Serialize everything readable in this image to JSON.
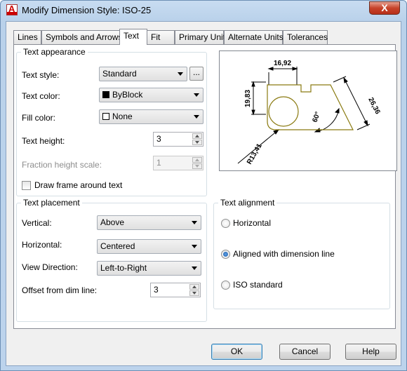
{
  "window": {
    "title": "Modify Dimension Style: ISO-25",
    "close_glyph": "X"
  },
  "tabs": [
    {
      "label": "Lines"
    },
    {
      "label": "Symbols and Arrows"
    },
    {
      "label": "Text",
      "active": true
    },
    {
      "label": "Fit"
    },
    {
      "label": "Primary Units"
    },
    {
      "label": "Alternate Units"
    },
    {
      "label": "Tolerances"
    }
  ],
  "text_appearance": {
    "title": "Text appearance",
    "text_style_label": "Text style:",
    "text_style_value": "Standard",
    "text_style_browse": "...",
    "text_color_label": "Text color:",
    "text_color_value": "ByBlock",
    "text_color_swatch": "#000000",
    "fill_color_label": "Fill color:",
    "fill_color_value": "None",
    "fill_color_swatch": "#ffffff",
    "text_height_label": "Text height:",
    "text_height_value": "3",
    "fraction_label": "Fraction height scale:",
    "fraction_value": "1",
    "draw_frame_label": "Draw frame around text",
    "draw_frame_checked": false
  },
  "preview": {
    "dim_top": "16,92",
    "dim_left": "19,83",
    "dim_right": "26,36",
    "dim_angle": "60°",
    "dim_radius": "R13,41"
  },
  "text_placement": {
    "title": "Text placement",
    "vertical_label": "Vertical:",
    "vertical_value": "Above",
    "horizontal_label": "Horizontal:",
    "horizontal_value": "Centered",
    "view_direction_label": "View Direction:",
    "view_direction_value": "Left-to-Right",
    "offset_label": "Offset from dim line:",
    "offset_value": "3"
  },
  "text_alignment": {
    "title": "Text alignment",
    "options": [
      {
        "label": "Horizontal",
        "selected": false
      },
      {
        "label": "Aligned with dimension line",
        "selected": true
      },
      {
        "label": "ISO standard",
        "selected": false
      }
    ]
  },
  "buttons": {
    "ok": "OK",
    "cancel": "Cancel",
    "help": "Help"
  }
}
